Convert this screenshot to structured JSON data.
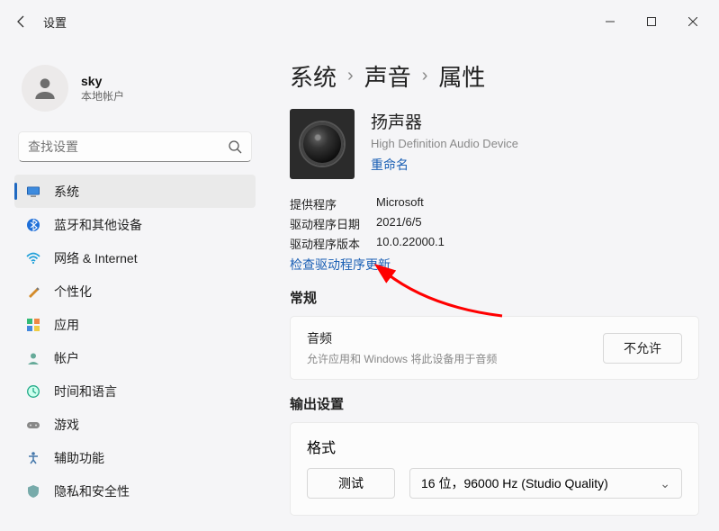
{
  "titlebar": {
    "title": "设置"
  },
  "profile": {
    "name": "sky",
    "sub": "本地帐户"
  },
  "search": {
    "placeholder": "查找设置"
  },
  "nav": [
    {
      "label": "系统",
      "active": true,
      "icon": "system"
    },
    {
      "label": "蓝牙和其他设备",
      "icon": "bluetooth"
    },
    {
      "label": "网络 & Internet",
      "icon": "wifi"
    },
    {
      "label": "个性化",
      "icon": "personalize"
    },
    {
      "label": "应用",
      "icon": "apps"
    },
    {
      "label": "帐户",
      "icon": "account"
    },
    {
      "label": "时间和语言",
      "icon": "time"
    },
    {
      "label": "游戏",
      "icon": "gaming"
    },
    {
      "label": "辅助功能",
      "icon": "a11y"
    },
    {
      "label": "隐私和安全性",
      "icon": "privacy"
    }
  ],
  "breadcrumb": {
    "a": "系统",
    "b": "声音",
    "c": "属性"
  },
  "device": {
    "name": "扬声器",
    "sub": "High Definition Audio Device",
    "rename": "重命名"
  },
  "driver": {
    "providerLabel": "提供程序",
    "provider": "Microsoft",
    "dateLabel": "驱动程序日期",
    "date": "2021/6/5",
    "versionLabel": "驱动程序版本",
    "version": "10.0.22000.1",
    "check": "检查驱动程序更新"
  },
  "general": {
    "title": "常规",
    "audio": {
      "title": "音频",
      "desc": "允许应用和 Windows 将此设备用于音频",
      "button": "不允许"
    }
  },
  "output": {
    "title": "输出设置",
    "format": {
      "title": "格式",
      "test": "测试",
      "value": "16 位，96000 Hz (Studio Quality)"
    }
  }
}
